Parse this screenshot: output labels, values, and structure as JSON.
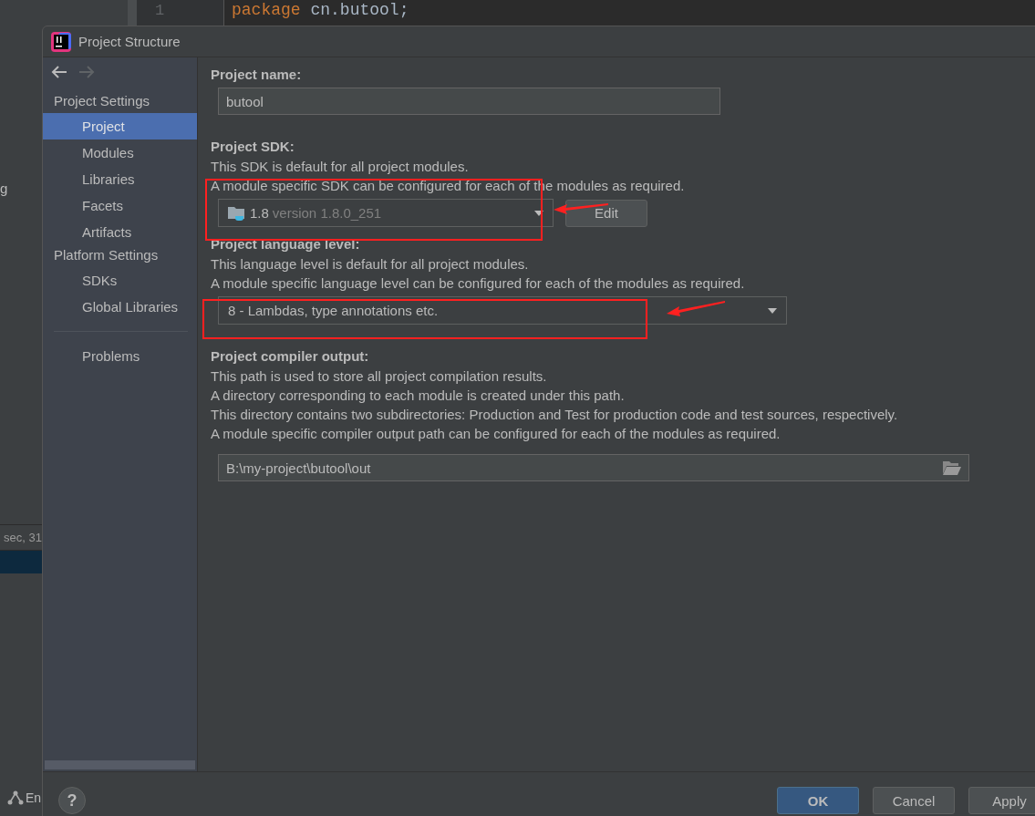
{
  "ide_background": {
    "line_number": "1",
    "code_keyword": "package",
    "code_rest": "cn.butool;",
    "left_fragments": [
      "g",
      "sec, 31",
      "En"
    ]
  },
  "window": {
    "title": "Project Structure"
  },
  "sidebar": {
    "sections": [
      {
        "title": "Project Settings",
        "items": [
          {
            "label": "Project",
            "selected": true
          },
          {
            "label": "Modules",
            "selected": false
          },
          {
            "label": "Libraries",
            "selected": false
          },
          {
            "label": "Facets",
            "selected": false
          },
          {
            "label": "Artifacts",
            "selected": false
          }
        ]
      },
      {
        "title": "Platform Settings",
        "items": [
          {
            "label": "SDKs",
            "selected": false
          },
          {
            "label": "Global Libraries",
            "selected": false
          }
        ]
      }
    ],
    "extra_items": [
      {
        "label": "Problems",
        "selected": false
      }
    ]
  },
  "project_name": {
    "label": "Project name:",
    "value": "butool"
  },
  "project_sdk": {
    "label": "Project SDK:",
    "description": [
      "This SDK is default for all project modules.",
      "A module specific SDK can be configured for each of the modules as required."
    ],
    "sdk_name": "1.8",
    "sdk_version": "version 1.8.0_251",
    "edit_button": "Edit"
  },
  "language_level": {
    "label": "Project language level:",
    "description": [
      "This language level is default for all project modules.",
      "A module specific language level can be configured for each of the modules as required."
    ],
    "value": "8 - Lambdas, type annotations etc."
  },
  "compiler_output": {
    "label": "Project compiler output:",
    "description": [
      "This path is used to store all project compilation results.",
      "A directory corresponding to each module is created under this path.",
      "This directory contains two subdirectories: Production and Test for production code and test sources, respectively.",
      "A module specific compiler output path can be configured for each of the modules as required."
    ],
    "value": "B:\\my-project\\butool\\out"
  },
  "buttons": [
    {
      "label": "OK",
      "kind": "primary"
    },
    {
      "label": "Cancel",
      "kind": "normal"
    },
    {
      "label": "Apply",
      "kind": "normal"
    }
  ],
  "help_button": "?"
}
